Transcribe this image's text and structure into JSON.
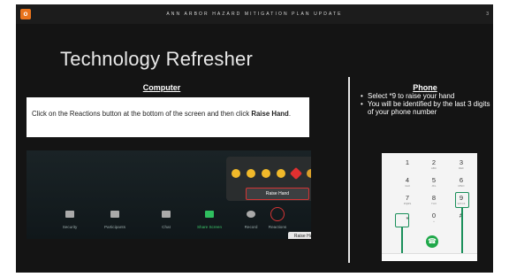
{
  "header": {
    "logo": "o",
    "title": "ANN ARBOR HAZARD MITIGATION PLAN UPDATE",
    "page_number": "3"
  },
  "slide": {
    "title": "Technology Refresher"
  },
  "computer": {
    "heading": "Computer",
    "instruction_prefix": "Click on the Reactions button at the bottom of the screen and then click ",
    "instruction_bold": "Raise Hand",
    "instruction_suffix": ".",
    "screenshot": {
      "raise_hand_button": "Raise Hand",
      "tooltip": "Raise Hand",
      "toolbar_items": [
        "Security",
        "Participants",
        "Chat",
        "Share Screen",
        "Record",
        "Reactions"
      ],
      "reaction_icons": [
        "clap-icon",
        "thumbs-up-icon",
        "joy-icon",
        "open-mouth-icon",
        "heart-icon",
        "party-icon"
      ]
    }
  },
  "phone": {
    "heading": "Phone",
    "bullets": [
      "Select *9 to raise your hand",
      "You will be identified by the last 3 digits of your phone number"
    ],
    "keypad": [
      {
        "digit": "1",
        "sub": ""
      },
      {
        "digit": "2",
        "sub": "ABC"
      },
      {
        "digit": "3",
        "sub": "DEF"
      },
      {
        "digit": "4",
        "sub": "GHI"
      },
      {
        "digit": "5",
        "sub": "JKL"
      },
      {
        "digit": "6",
        "sub": "MNO"
      },
      {
        "digit": "7",
        "sub": "PQRS"
      },
      {
        "digit": "8",
        "sub": "TUV"
      },
      {
        "digit": "9",
        "sub": "WXYZ"
      },
      {
        "digit": "*",
        "sub": ""
      },
      {
        "digit": "0",
        "sub": "+"
      },
      {
        "digit": "#",
        "sub": ""
      }
    ]
  },
  "colors": {
    "accent": "#e8731c",
    "highlight_red": "#d43535",
    "highlight_green": "#1a8f5a",
    "call_green": "#1fa84a"
  }
}
